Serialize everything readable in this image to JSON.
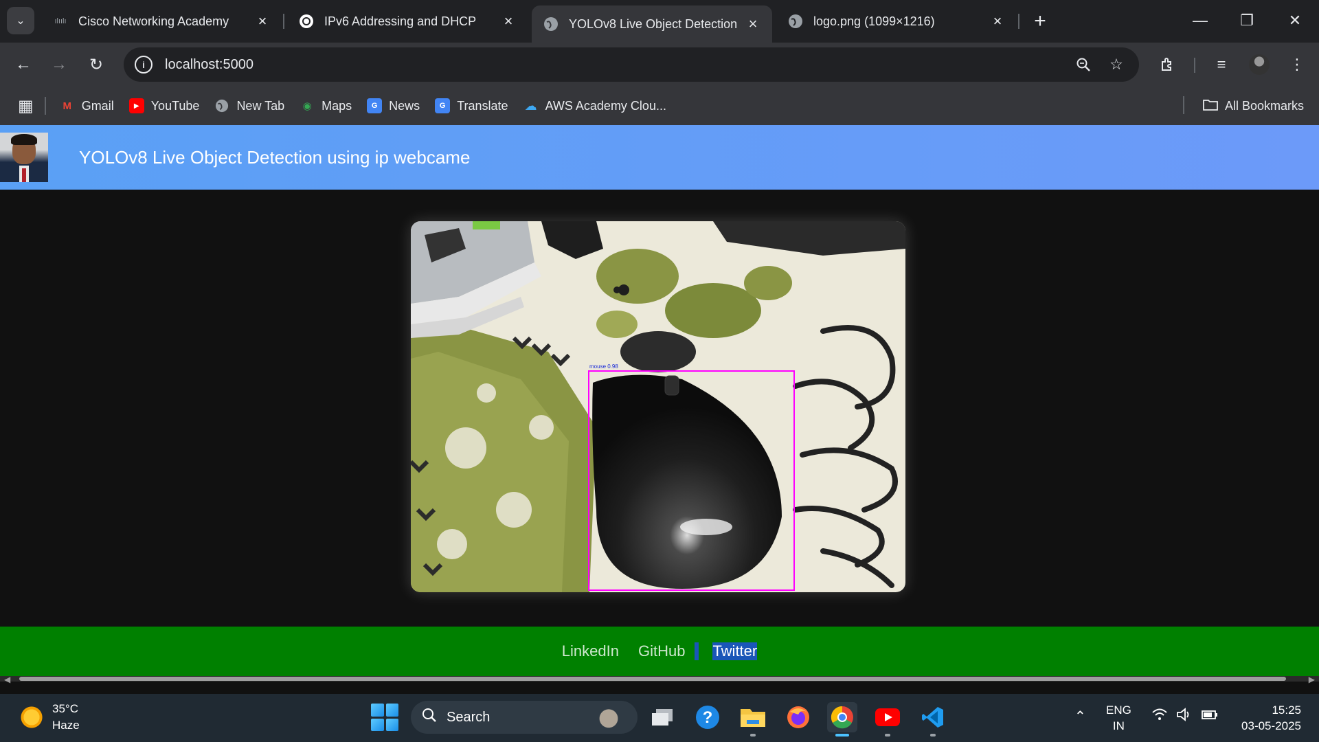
{
  "browser": {
    "tabs": [
      {
        "title": "Cisco Networking Academy",
        "favicon": "cisco-icon",
        "active": false
      },
      {
        "title": "IPv6 Addressing and DHCP",
        "favicon": "openai-icon",
        "active": false
      },
      {
        "title": "YOLOv8 Live Object Detection",
        "favicon": "globe-icon",
        "active": true
      },
      {
        "title": "logo.png (1099×1216)",
        "favicon": "globe-icon",
        "active": false
      }
    ],
    "url": "localhost:5000",
    "bookmarks": [
      {
        "label": "Gmail",
        "icon": "gmail-icon",
        "color": "#ea4335"
      },
      {
        "label": "YouTube",
        "icon": "youtube-icon",
        "color": "#ff0000"
      },
      {
        "label": "New Tab",
        "icon": "globe-icon",
        "color": "#9aa0a6"
      },
      {
        "label": "Maps",
        "icon": "maps-icon",
        "color": "#34a853"
      },
      {
        "label": "News",
        "icon": "news-icon",
        "color": "#4285f4"
      },
      {
        "label": "Translate",
        "icon": "translate-icon",
        "color": "#4285f4"
      },
      {
        "label": "AWS Academy Clou...",
        "icon": "cloud-icon",
        "color": "#3ea8f2"
      }
    ],
    "all_bookmarks_label": "All Bookmarks"
  },
  "page": {
    "header_title": "YOLOv8 Live Object Detection using ip webcame",
    "header_color": "#5aa0f5",
    "detection": {
      "label": "mouse 0.98",
      "box_color": "#ff00ff"
    },
    "footer": {
      "links": [
        "LinkedIn",
        "GitHub",
        "Twitter"
      ],
      "background": "#008000"
    }
  },
  "taskbar": {
    "weather_temp": "35°C",
    "weather_desc": "Haze",
    "search_placeholder": "Search",
    "lang_top": "ENG",
    "lang_bottom": "IN",
    "time": "15:25",
    "date": "03-05-2025"
  }
}
